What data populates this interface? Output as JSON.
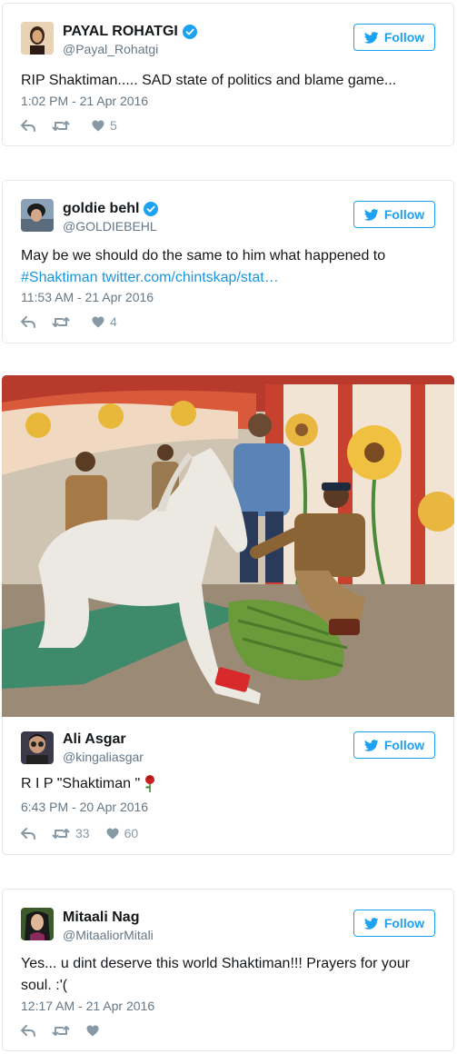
{
  "follow_label": "Follow",
  "tweets": [
    {
      "name": "PAYAL ROHATGI",
      "handle": "@Payal_Rohatgi",
      "verified": true,
      "text": "RIP Shaktiman..... SAD state of politics and blame game...",
      "time": "1:02 PM - 21 Apr 2016",
      "retweets": "",
      "likes": "5"
    },
    {
      "name": "goldie behl",
      "handle": "@GOLDIEBEHL",
      "verified": true,
      "text_line1": "May be we should do the same to him what happened to",
      "text_hashtag": "#Shaktiman",
      "text_url": "twitter.com/chintskap/stat…",
      "time": "11:53 AM - 21 Apr 2016",
      "retweets": "",
      "likes": "4"
    },
    {
      "name": "Ali Asgar",
      "handle": "@kingaliasgar",
      "verified": false,
      "text": "R I P \"Shaktiman \"",
      "time": "6:43 PM - 20 Apr 2016",
      "retweets": "33",
      "likes": "60"
    },
    {
      "name": "Mitaali Nag",
      "handle": "@MitaaliorMitali",
      "verified": false,
      "text": "Yes... u dint deserve this world Shaktiman!!! Prayers for your soul. :'(",
      "time": "12:17 AM - 21 Apr 2016",
      "retweets": "",
      "likes": ""
    }
  ],
  "colors": {
    "accent": "#1da1f2",
    "link": "#1b95e0",
    "meta": "#657786",
    "icon": "#8899a6",
    "border": "#e1e8ed"
  }
}
